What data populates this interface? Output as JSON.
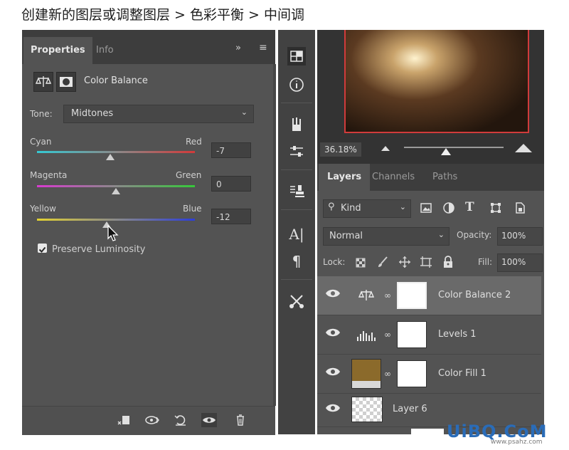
{
  "caption": "创建新的图层或调整图层 > 色彩平衡 > 中间调",
  "properties": {
    "tabs": [
      "Properties",
      "Info"
    ],
    "panel_title": "Color Balance",
    "tone_label": "Tone:",
    "tone_value": "Midtones",
    "sliders": [
      {
        "left": "Cyan",
        "right": "Red",
        "value": "-7",
        "level": -7
      },
      {
        "left": "Magenta",
        "right": "Green",
        "value": "0",
        "level": 0
      },
      {
        "left": "Yellow",
        "right": "Blue",
        "value": "-12",
        "level": -12
      }
    ],
    "preserve_label": "Preserve Luminosity",
    "preserve_checked": true
  },
  "navigator": {
    "zoom": "36.18%"
  },
  "layers": {
    "tabs": [
      "Layers",
      "Channels",
      "Paths"
    ],
    "filter_label": "Kind",
    "blend_mode": "Normal",
    "opacity_label": "Opacity:",
    "opacity_value": "100%",
    "lock_label": "Lock:",
    "fill_label": "Fill:",
    "fill_value": "100%",
    "items": [
      {
        "name": "Color Balance 2",
        "selected": true
      },
      {
        "name": "Levels 1",
        "selected": false
      },
      {
        "name": "Color Fill 1",
        "selected": false
      },
      {
        "name": "Layer 6",
        "selected": false
      }
    ]
  },
  "watermark": {
    "logo": "UiBQ.CoM",
    "url": "www.psahz.com"
  },
  "colors": {
    "panel": "#535353",
    "dark": "#3d3d3d",
    "selection": "#d13b3b",
    "fill_swatch": "#8b6a2b"
  }
}
